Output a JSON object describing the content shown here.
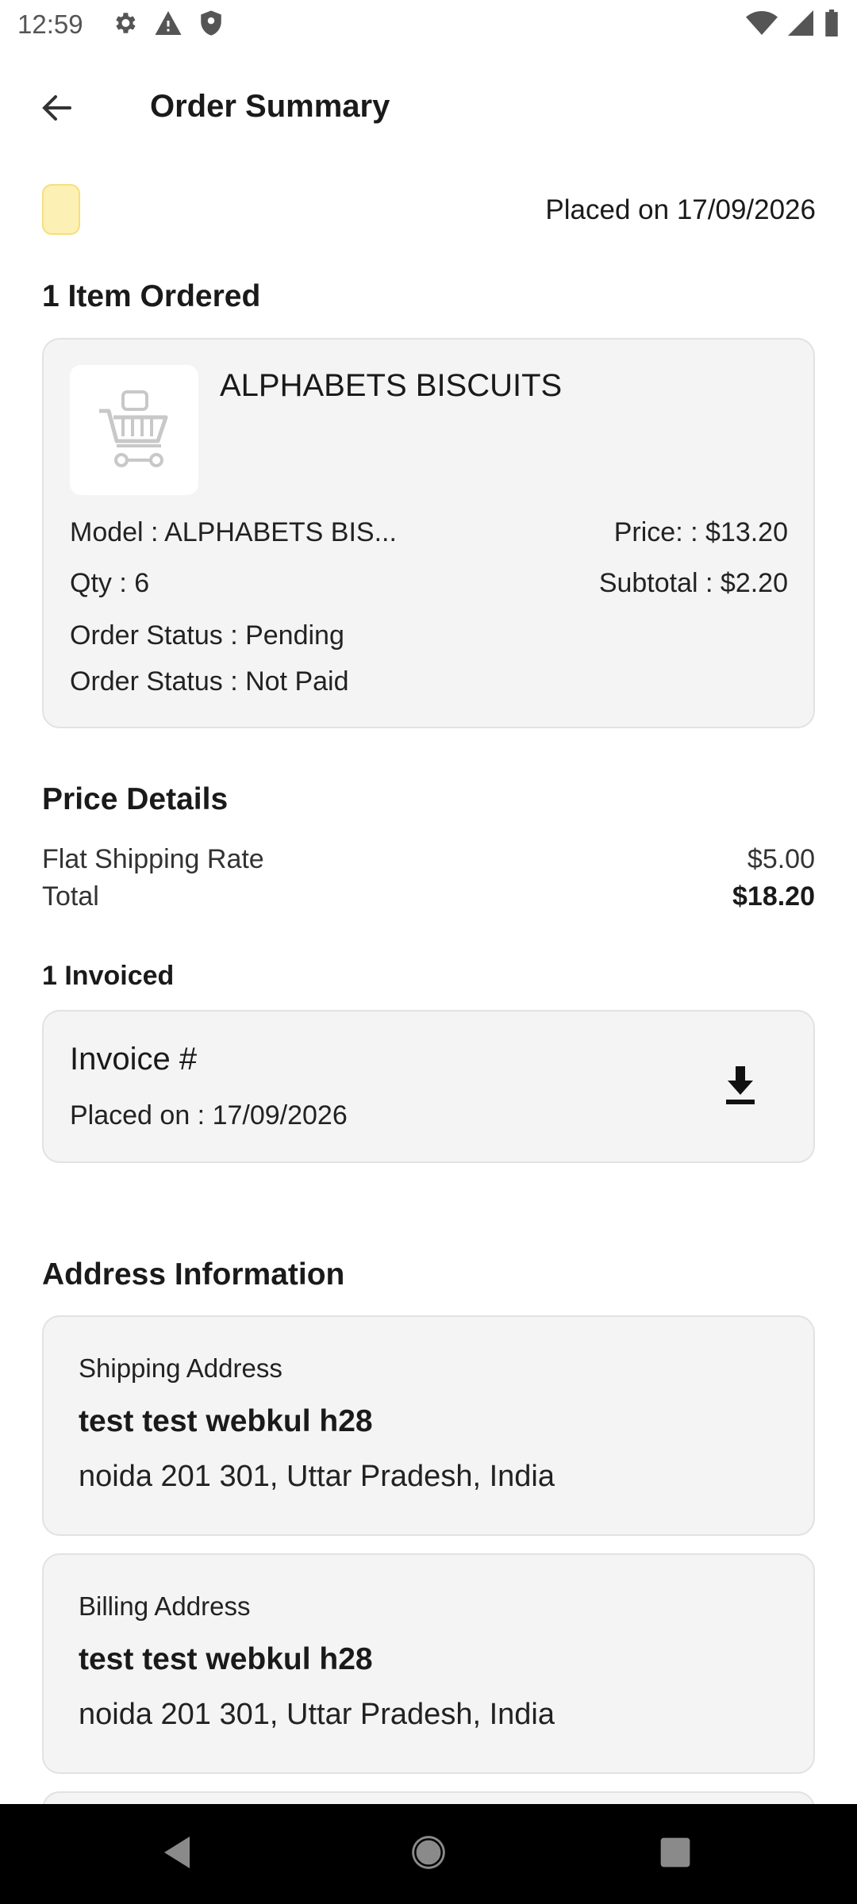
{
  "status_bar": {
    "time": "12:59",
    "left_icons": [
      "gear-icon",
      "warning-icon",
      "shield-icon"
    ],
    "right_icons": [
      "wifi-icon",
      "signal-icon",
      "battery-icon"
    ]
  },
  "app_bar": {
    "title": "Order Summary",
    "back_icon": "arrow-left-icon"
  },
  "order": {
    "status_chip_color": "#fdf0b4",
    "placed_on": "Placed on 17/09/2026",
    "items_heading": "1 Item Ordered"
  },
  "item": {
    "name": "ALPHABETS BISCUITS",
    "model": "Model : ALPHABETS BIS...",
    "price": "Price:  : $13.20",
    "qty": "Qty : 6",
    "subtotal": "Subtotal : $2.20",
    "order_status": "Order Status : Pending",
    "payment_status": "Order Status : Not Paid",
    "thumb_icon": "shopping-cart-icon"
  },
  "price_details": {
    "heading": "Price Details",
    "rows": [
      {
        "label": "Flat Shipping Rate",
        "value": "$5.00"
      },
      {
        "label": "Total",
        "value": "$18.20"
      }
    ]
  },
  "invoice": {
    "heading": "1 Invoiced",
    "title": "Invoice #",
    "placed_on": "Placed on : 17/09/2026",
    "download_icon": "download-icon"
  },
  "address": {
    "heading": "Address Information",
    "shipping": {
      "label": "Shipping Address",
      "name": "test test webkul h28",
      "line": "noida 201 301, Uttar Pradesh, India"
    },
    "billing": {
      "label": "Billing Address",
      "name": "test test webkul h28",
      "line": "noida 201 301, Uttar Pradesh, India"
    }
  },
  "nav_bar": {
    "icons": [
      "nav-back-icon",
      "nav-home-icon",
      "nav-recents-icon"
    ]
  }
}
